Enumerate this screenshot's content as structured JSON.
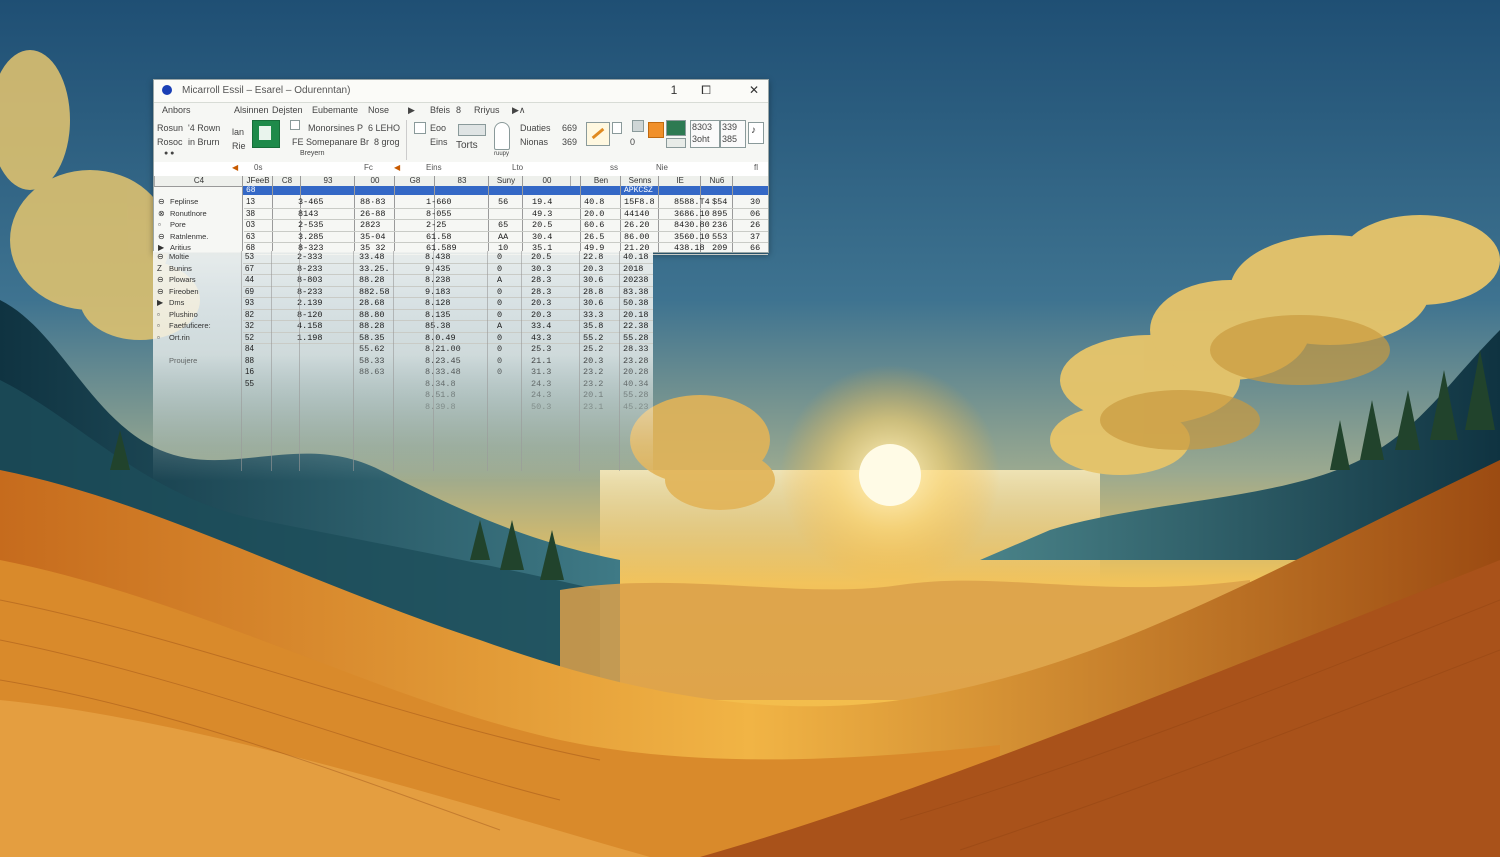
{
  "window": {
    "title": "Micarroll Essil – Esarel – Odurenntan)",
    "btn_1": "1",
    "btn_restore": "⧠",
    "btn_close": "✕"
  },
  "ribbon_tabs": [
    "Anbors",
    "Alsinnen",
    "Dejsten",
    "Eubemante",
    "Nose",
    "Bfeis",
    "8",
    "Rriyus"
  ],
  "ribbon": {
    "g1_line1": "Rosun",
    "g1_line2": "Rosoc",
    "g2_line1": "'4 Rown",
    "g2_line2": "in Brurn",
    "g3_line1": "lan",
    "g3_line2": "Rie",
    "font_name": "Monorsines P",
    "font_line2": "FE Somepanare Br",
    "font_size_a": "6 LEHO",
    "font_size_b": "8 grog",
    "group_label_1": "Breyern",
    "g4_line1": "Eoo",
    "g4_line2": "Eins",
    "g5": "Torts",
    "g6_line1": "Duaties",
    "g6_line2": "Nionas",
    "g6_label": "ruupy",
    "num_a": "669",
    "num_b": "369",
    "num_c": "8303",
    "num_d": "3oht",
    "num_e": "339",
    "num_f": "385"
  },
  "formula_bar": {
    "name_box": "0s",
    "fx_label": "Fc",
    "content": "Eins",
    "right_a": "Lto",
    "right_b": "ss",
    "right_c": "Nie",
    "right_d": "fl"
  },
  "column_headers": [
    "C4",
    "JFeeB",
    "C8",
    "93",
    "00",
    "G8",
    "83",
    "Suny",
    "00",
    "",
    "Ben",
    "Senns",
    "IE",
    "Nu6"
  ],
  "selected_row_labels": [
    "",
    "68",
    "",
    "",
    "",
    "",
    "",
    "",
    "",
    "",
    "",
    "APKCSZ",
    "",
    ""
  ],
  "rows": [
    {
      "label": "Feplinse",
      "num": "13",
      "c": [
        "3-465",
        "88·83",
        "1-660",
        "56",
        "19.4",
        "40.8",
        "15F8.8",
        "8588.T4",
        "$54",
        "30"
      ]
    },
    {
      "label": "Ronutlnore",
      "num": "38",
      "c": [
        "8143",
        "26-88",
        "8-055",
        "",
        "49.3",
        "20.0",
        "44140",
        "3686.10",
        "895",
        "06"
      ]
    },
    {
      "label": "Pore",
      "num": "03",
      "c": [
        "2-535",
        "2823",
        "2-25",
        "65",
        "20.5",
        "60.6",
        "26.20",
        "8430.80",
        "236",
        "26"
      ]
    },
    {
      "label": "Ratnlenme.",
      "num": "63",
      "c": [
        "3.285",
        "35-04",
        "61.58",
        "AA",
        "30.4",
        "26.5",
        "86.00",
        "3560.10",
        "553",
        "37"
      ]
    },
    {
      "label": "Aritius",
      "num": "68",
      "c": [
        "8-323",
        "35 32",
        "61.589",
        "10",
        "35.1",
        "49.9",
        "21.20",
        "438.18",
        "209",
        "66"
      ]
    },
    {
      "label": "Moltie",
      "num": "53",
      "c": [
        "2-333",
        "33.48",
        "8.438",
        "0",
        "20.5",
        "22.8",
        "40.18",
        "",
        "",
        ""
      ]
    },
    {
      "label": "Bunins",
      "num": "67",
      "c": [
        "8-233",
        "33.25.",
        "9.435",
        "0",
        "30.3",
        "20.3",
        "2018",
        "",
        "",
        ""
      ]
    },
    {
      "label": "Plowars",
      "num": "44",
      "c": [
        "8-803",
        "88.28",
        "8.238",
        "A",
        "28.3",
        "30.6",
        "20238",
        "",
        "",
        ""
      ]
    },
    {
      "label": "Fireoben",
      "num": "69",
      "c": [
        "8-233",
        "882.58",
        "9.183",
        "0",
        "28.3",
        "28.8",
        "83.38",
        "",
        "",
        ""
      ]
    },
    {
      "label": "Dms",
      "num": "93",
      "c": [
        "2.139",
        "28.68",
        "8.128",
        "0",
        "20.3",
        "30.6",
        "50.38",
        "",
        "",
        ""
      ]
    },
    {
      "label": "Plushino",
      "num": "82",
      "c": [
        "8-120",
        "88.80",
        "8.135",
        "0",
        "20.3",
        "33.3",
        "20.18",
        "",
        "",
        ""
      ]
    },
    {
      "label": "Faetfuficere:",
      "num": "32",
      "c": [
        "4.158",
        "88.28",
        "85.38",
        "A",
        "33.4",
        "35.8",
        "22.38",
        "",
        "",
        ""
      ]
    },
    {
      "label": "Ort.rin",
      "num": "52",
      "c": [
        "1.198",
        "58.35",
        "8.0.49",
        "0",
        "43.3",
        "55.2",
        "55.28",
        "",
        "",
        ""
      ]
    }
  ],
  "faded_rows": [
    {
      "label": "",
      "num": "84",
      "c": [
        "",
        "55.62",
        "8.21.00",
        "0",
        "25.3",
        "25.2",
        "28.33"
      ]
    },
    {
      "label": "Proujere",
      "num": "88",
      "c": [
        "",
        "58.33",
        "8.23.45",
        "0",
        "21.1",
        "20.3",
        "23.28"
      ]
    },
    {
      "label": "",
      "num": "16",
      "c": [
        "",
        "88.63",
        "8.33.48",
        "0",
        "31.3",
        "23.2",
        "20.28"
      ]
    },
    {
      "label": "",
      "num": "55",
      "c": [
        "",
        "",
        "8.34.8",
        "",
        "24.3",
        "23.2",
        "40.34"
      ]
    },
    {
      "label": "",
      "num": "",
      "c": [
        "",
        "",
        "8.51.8",
        "",
        "24.3",
        "20.1",
        "55.28"
      ]
    },
    {
      "label": "",
      "num": "",
      "c": [
        "",
        "",
        "8.39.8",
        "",
        "50.3",
        "23.1",
        "45.23"
      ]
    }
  ]
}
